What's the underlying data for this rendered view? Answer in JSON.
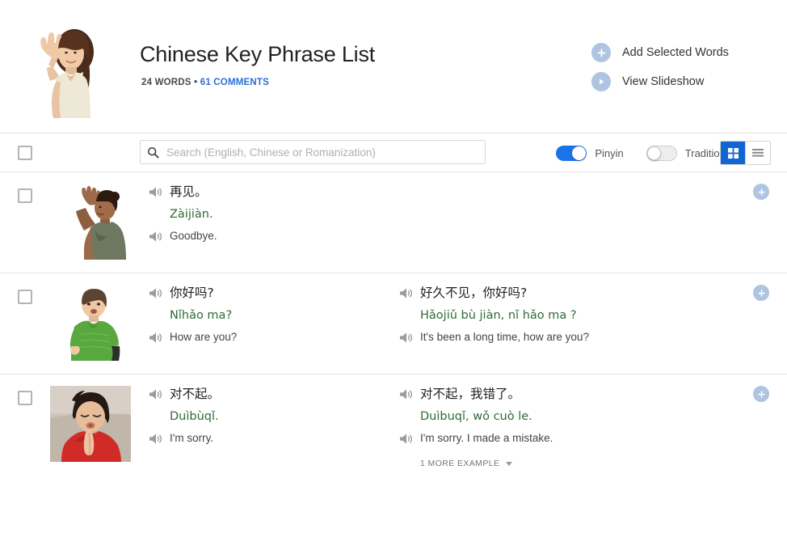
{
  "header": {
    "title": "Chinese Key Phrase List",
    "word_count": "24 WORDS",
    "separator": "•",
    "comments": "61 COMMENTS",
    "hero_image_alt": "woman-waving-photo",
    "actions": [
      {
        "icon": "plus-icon",
        "label": "Add Selected Words"
      },
      {
        "icon": "play-icon",
        "label": "View Slideshow"
      }
    ]
  },
  "toolbar": {
    "select_all_checkbox": "",
    "search": {
      "value": "",
      "placeholder": "Search (English, Chinese or Romanization)",
      "icon": "search-icon"
    },
    "toggles": [
      {
        "label": "Pinyin",
        "state": "on"
      },
      {
        "label": "Traditional",
        "state": "off"
      }
    ],
    "view_modes": [
      {
        "name": "grid-view",
        "active": true
      },
      {
        "name": "list-view",
        "active": false
      }
    ],
    "accent_color": "#1a73e8",
    "active_view_color": "#1266d4"
  },
  "rows": [
    {
      "thumb_alt": "woman-waving-goodbye-photo",
      "add_label": "+",
      "examples": [
        {
          "hanzi": "再见。",
          "pinyin": "Zàijiàn.",
          "english": "Goodbye."
        }
      ],
      "more_examples": null
    },
    {
      "thumb_alt": "boy-in-green-shirt-photo",
      "add_label": "+",
      "examples": [
        {
          "hanzi": "你好吗?",
          "pinyin": "Nǐhǎo ma?",
          "english": "How are you?"
        },
        {
          "hanzi": "好久不见，你好吗?",
          "pinyin": "Hǎojiǔ bù jiàn, nǐ hǎo ma ?",
          "english": "It's been a long time, how are you?"
        }
      ],
      "more_examples": null
    },
    {
      "thumb_alt": "child-in-red-apologizing-photo",
      "add_label": "+",
      "examples": [
        {
          "hanzi": "对不起。",
          "pinyin": "Duìbùqǐ.",
          "english": "I'm sorry."
        },
        {
          "hanzi": "对不起，我错了。",
          "pinyin": "Duìbuqǐ, wǒ cuò le.",
          "english": "I'm sorry. I made a mistake.",
          "more_examples": "1 MORE EXAMPLE"
        }
      ]
    }
  ],
  "colors": {
    "pinyin_green": "#2f6b37",
    "link_blue": "#2b6fd6",
    "action_circle": "#aec4e0",
    "divider": "#e4e4e4"
  }
}
